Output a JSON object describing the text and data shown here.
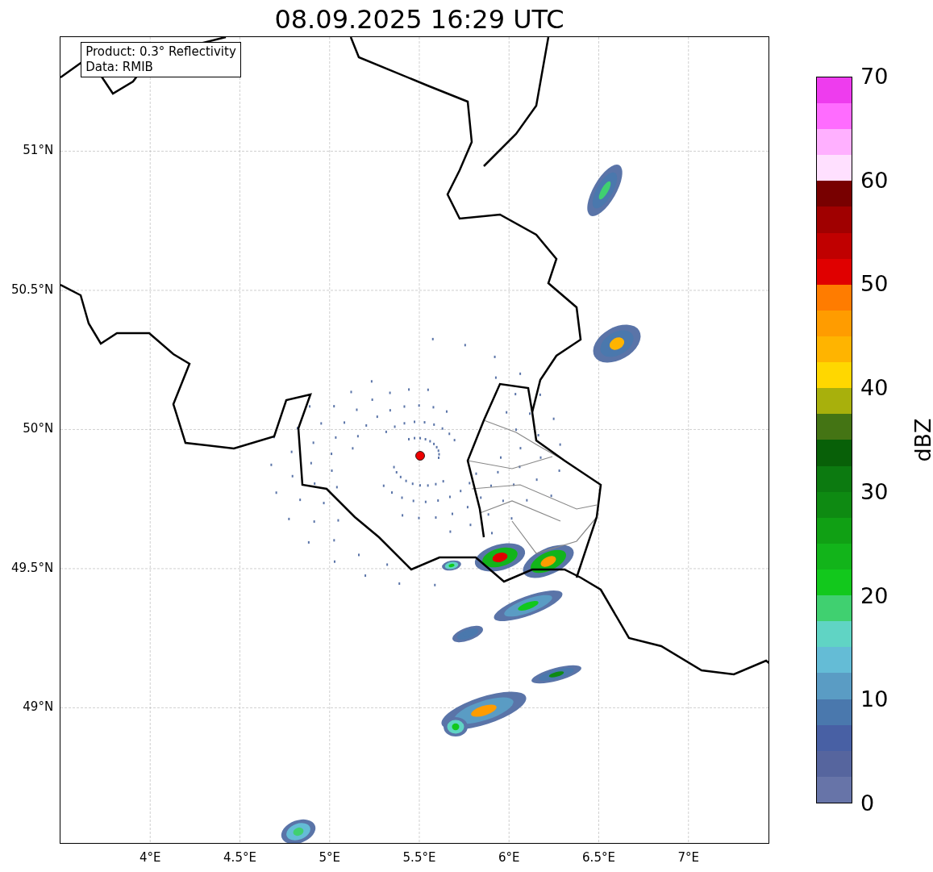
{
  "title": "08.09.2025 16:29 UTC",
  "map": {
    "info_lines": [
      "Product: 0.3° Reflectivity",
      "Data: RMIB"
    ],
    "lat_ticks": [
      "51°N",
      "50.5°N",
      "50°N",
      "49.5°N",
      "49°N"
    ],
    "lon_ticks": [
      "4°E",
      "4.5°E",
      "5°E",
      "5.5°E",
      "6°E",
      "6.5°E",
      "7°E"
    ]
  },
  "colorbar": {
    "label": "dBZ",
    "ticks": [
      "70",
      "60",
      "50",
      "40",
      "30",
      "20",
      "10",
      "0"
    ],
    "bins": [
      {
        "color": "#6774a8"
      },
      {
        "color": "#56659e"
      },
      {
        "color": "#4860a4"
      },
      {
        "color": "#4a78ad"
      },
      {
        "color": "#5a9cc4"
      },
      {
        "color": "#64bcd6"
      },
      {
        "color": "#60d4c4"
      },
      {
        "color": "#40d070"
      },
      {
        "color": "#12c81c"
      },
      {
        "color": "#12b41a"
      },
      {
        "color": "#10a014"
      },
      {
        "color": "#0e8a12"
      },
      {
        "color": "#0c7a10"
      },
      {
        "color": "#086008"
      },
      {
        "color": "#447414"
      },
      {
        "color": "#a8b00c"
      },
      {
        "color": "#ffd700"
      },
      {
        "color": "#ffb400"
      },
      {
        "color": "#ff9c00"
      },
      {
        "color": "#ff7c00"
      },
      {
        "color": "#e00000"
      },
      {
        "color": "#c00000"
      },
      {
        "color": "#a00000"
      },
      {
        "color": "#780000"
      },
      {
        "color": "#ffe0ff"
      },
      {
        "color": "#ffb0ff"
      },
      {
        "color": "#ff6cff"
      },
      {
        "color": "#ee3cee"
      }
    ]
  }
}
